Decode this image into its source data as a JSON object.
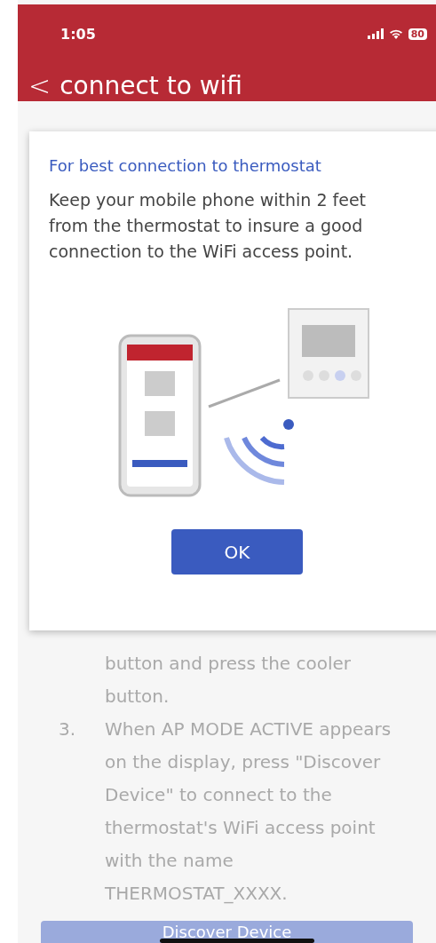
{
  "status_bar": {
    "time": "1:05",
    "battery": "80"
  },
  "header": {
    "back": "<",
    "title": "connect to wifi"
  },
  "steps": [
    {
      "text": "button and press the cooler button."
    },
    {
      "number": "3.",
      "text": "When AP MODE ACTIVE appears on the display, press \"Discover Device\" to connect to the thermostat's WiFi access point with the name THERMOSTAT_XXXX."
    }
  ],
  "primary_button": {
    "label": "Discover Device",
    "disabled": true
  },
  "dialog": {
    "title": "For best connection to thermostat",
    "message": "Keep your mobile phone within 2 feet from  the thermostat to insure a good connection to the WiFi access point.",
    "button": "OK"
  }
}
